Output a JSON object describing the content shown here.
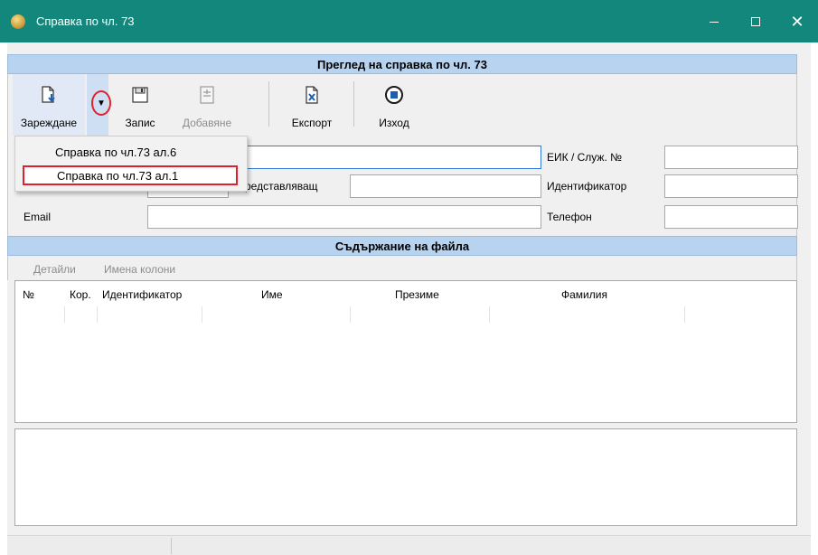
{
  "window": {
    "title": "Справка по чл. 73"
  },
  "sections": {
    "review_header": "Преглед на справка по чл. 73",
    "content_header": "Съдържание на файла"
  },
  "toolbar": {
    "load_label": "Зареждане",
    "save_label": "Запис",
    "add_label": "Добавяне",
    "export_label": "Експорт",
    "exit_label": "Изход"
  },
  "dropdown": {
    "items": [
      "Справка по чл.73 ал.6",
      "Справка по чл.73 ал.1"
    ],
    "highlighted_index": 1
  },
  "form": {
    "representative_label": "редставляващ",
    "email_label": "Email",
    "eik_label": "ЕИК / Служ. №",
    "identifier_label": "Идентификатор",
    "phone_label": "Телефон",
    "values": {
      "name": "",
      "representative": "",
      "email": "",
      "eik": "",
      "identifier": "",
      "phone": ""
    }
  },
  "content_tabs": {
    "details": "Детайли",
    "column_names": "Имена колони"
  },
  "table": {
    "columns": [
      "№",
      "Кор.",
      "Идентификатор",
      "Име",
      "Презиме",
      "Фамилия"
    ],
    "rows": []
  },
  "colors": {
    "titlebar": "#13877b",
    "section_header": "#b7d3ef",
    "highlight": "#e0202a"
  }
}
